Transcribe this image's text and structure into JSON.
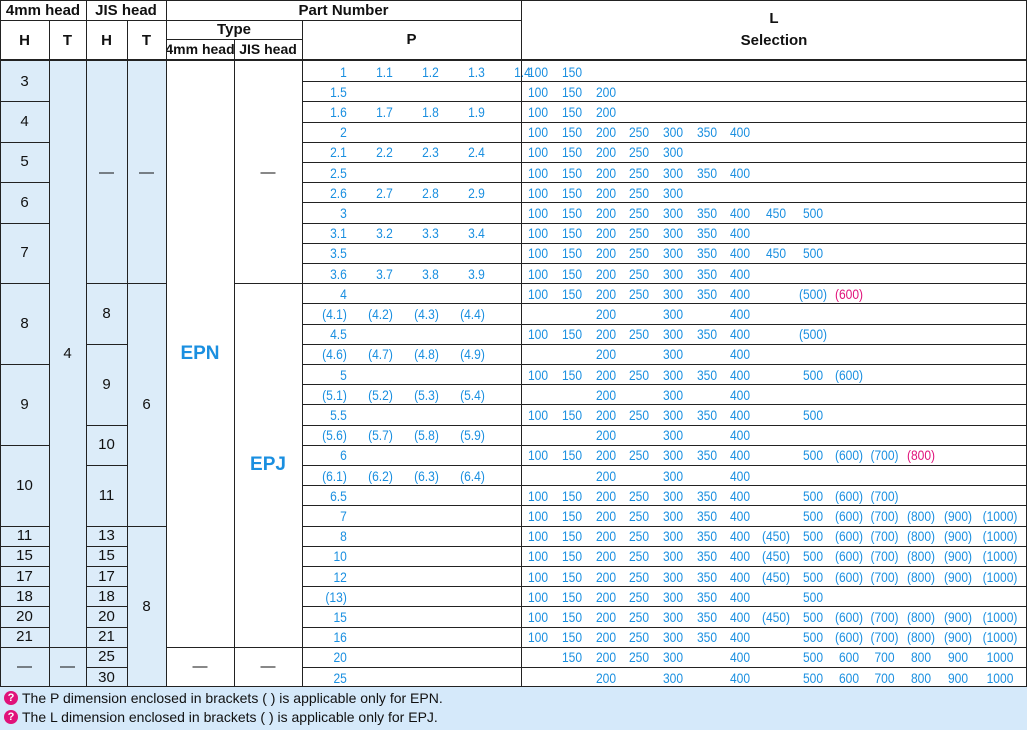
{
  "header": {
    "group_4mm": "4mm head",
    "group_jis": "JIS head",
    "part_number": "Part Number",
    "type": "Type",
    "type_4mm": "4mm head",
    "type_jis": "JIS head",
    "h": "H",
    "t": "T",
    "p": "P",
    "l": "L",
    "selection": "Selection"
  },
  "rows": [
    {
      "p": [
        "1",
        "1.1",
        "1.2",
        "1.3",
        "1.4"
      ],
      "l": [
        "100",
        "150",
        "",
        "",
        "",
        "",
        "",
        "",
        "",
        "",
        "",
        "",
        "",
        ""
      ]
    },
    {
      "p": [
        "1.5"
      ],
      "l": [
        "100",
        "150",
        "200",
        "",
        "",
        "",
        "",
        "",
        "",
        "",
        "",
        "",
        "",
        ""
      ]
    },
    {
      "p": [
        "1.6",
        "1.7",
        "1.8",
        "1.9"
      ],
      "l": [
        "100",
        "150",
        "200",
        "",
        "",
        "",
        "",
        "",
        "",
        "",
        "",
        "",
        "",
        ""
      ]
    },
    {
      "p": [
        "2"
      ],
      "l": [
        "100",
        "150",
        "200",
        "250",
        "300",
        "350",
        "400",
        "",
        "",
        "",
        "",
        "",
        "",
        ""
      ]
    },
    {
      "p": [
        "2.1",
        "2.2",
        "2.3",
        "2.4"
      ],
      "l": [
        "100",
        "150",
        "200",
        "250",
        "300",
        "",
        "",
        "",
        "",
        "",
        "",
        "",
        "",
        ""
      ]
    },
    {
      "p": [
        "2.5"
      ],
      "l": [
        "100",
        "150",
        "200",
        "250",
        "300",
        "350",
        "400",
        "",
        "",
        "",
        "",
        "",
        "",
        ""
      ]
    },
    {
      "p": [
        "2.6",
        "2.7",
        "2.8",
        "2.9"
      ],
      "l": [
        "100",
        "150",
        "200",
        "250",
        "300",
        "",
        "",
        "",
        "",
        "",
        "",
        "",
        "",
        ""
      ]
    },
    {
      "p": [
        "3"
      ],
      "l": [
        "100",
        "150",
        "200",
        "250",
        "300",
        "350",
        "400",
        "450",
        "500",
        "",
        "",
        "",
        "",
        ""
      ]
    },
    {
      "p": [
        "3.1",
        "3.2",
        "3.3",
        "3.4"
      ],
      "l": [
        "100",
        "150",
        "200",
        "250",
        "300",
        "350",
        "400",
        "",
        "",
        "",
        "",
        "",
        "",
        ""
      ]
    },
    {
      "p": [
        "3.5"
      ],
      "l": [
        "100",
        "150",
        "200",
        "250",
        "300",
        "350",
        "400",
        "450",
        "500",
        "",
        "",
        "",
        "",
        ""
      ]
    },
    {
      "p": [
        "3.6",
        "3.7",
        "3.8",
        "3.9"
      ],
      "l": [
        "100",
        "150",
        "200",
        "250",
        "300",
        "350",
        "400",
        "",
        "",
        "",
        "",
        "",
        "",
        ""
      ]
    },
    {
      "p": [
        "4"
      ],
      "l": [
        "100",
        "150",
        "200",
        "250",
        "300",
        "350",
        "400",
        "",
        "(500)",
        "(600)",
        "",
        "",
        "",
        ""
      ],
      "pink": [
        9
      ]
    },
    {
      "p": [
        "(4.1)",
        "(4.2)",
        "(4.3)",
        "(4.4)"
      ],
      "l": [
        "",
        "",
        "200",
        "",
        "300",
        "",
        "400",
        "",
        "",
        "",
        "",
        "",
        "",
        ""
      ]
    },
    {
      "p": [
        "4.5"
      ],
      "l": [
        "100",
        "150",
        "200",
        "250",
        "300",
        "350",
        "400",
        "",
        "(500)",
        "",
        "",
        "",
        "",
        ""
      ]
    },
    {
      "p": [
        "(4.6)",
        "(4.7)",
        "(4.8)",
        "(4.9)"
      ],
      "l": [
        "",
        "",
        "200",
        "",
        "300",
        "",
        "400",
        "",
        "",
        "",
        "",
        "",
        "",
        ""
      ]
    },
    {
      "p": [
        "5"
      ],
      "l": [
        "100",
        "150",
        "200",
        "250",
        "300",
        "350",
        "400",
        "",
        "500",
        "(600)",
        "",
        "",
        "",
        ""
      ]
    },
    {
      "p": [
        "(5.1)",
        "(5.2)",
        "(5.3)",
        "(5.4)"
      ],
      "l": [
        "",
        "",
        "200",
        "",
        "300",
        "",
        "400",
        "",
        "",
        "",
        "",
        "",
        "",
        ""
      ]
    },
    {
      "p": [
        "5.5"
      ],
      "l": [
        "100",
        "150",
        "200",
        "250",
        "300",
        "350",
        "400",
        "",
        "500",
        "",
        "",
        "",
        "",
        ""
      ]
    },
    {
      "p": [
        "(5.6)",
        "(5.7)",
        "(5.8)",
        "(5.9)"
      ],
      "l": [
        "",
        "",
        "200",
        "",
        "300",
        "",
        "400",
        "",
        "",
        "",
        "",
        "",
        "",
        ""
      ]
    },
    {
      "p": [
        "6"
      ],
      "l": [
        "100",
        "150",
        "200",
        "250",
        "300",
        "350",
        "400",
        "",
        "500",
        "(600)",
        "(700)",
        "(800)",
        "",
        ""
      ],
      "pink": [
        11
      ]
    },
    {
      "p": [
        "(6.1)",
        "(6.2)",
        "(6.3)",
        "(6.4)"
      ],
      "l": [
        "",
        "",
        "200",
        "",
        "300",
        "",
        "400",
        "",
        "",
        "",
        "",
        "",
        "",
        ""
      ]
    },
    {
      "p": [
        "6.5"
      ],
      "l": [
        "100",
        "150",
        "200",
        "250",
        "300",
        "350",
        "400",
        "",
        "500",
        "(600)",
        "(700)",
        "",
        "",
        ""
      ]
    },
    {
      "p": [
        "7"
      ],
      "l": [
        "100",
        "150",
        "200",
        "250",
        "300",
        "350",
        "400",
        "",
        "500",
        "(600)",
        "(700)",
        "(800)",
        "(900)",
        "(1000)"
      ]
    },
    {
      "p": [
        "8"
      ],
      "l": [
        "100",
        "150",
        "200",
        "250",
        "300",
        "350",
        "400",
        "(450)",
        "500",
        "(600)",
        "(700)",
        "(800)",
        "(900)",
        "(1000)"
      ]
    },
    {
      "p": [
        "10"
      ],
      "l": [
        "100",
        "150",
        "200",
        "250",
        "300",
        "350",
        "400",
        "(450)",
        "500",
        "(600)",
        "(700)",
        "(800)",
        "(900)",
        "(1000)"
      ]
    },
    {
      "p": [
        "12"
      ],
      "l": [
        "100",
        "150",
        "200",
        "250",
        "300",
        "350",
        "400",
        "(450)",
        "500",
        "(600)",
        "(700)",
        "(800)",
        "(900)",
        "(1000)"
      ]
    },
    {
      "p": [
        "(13)"
      ],
      "l": [
        "100",
        "150",
        "200",
        "250",
        "300",
        "350",
        "400",
        "",
        "500",
        "",
        "",
        "",
        "",
        ""
      ]
    },
    {
      "p": [
        "15"
      ],
      "l": [
        "100",
        "150",
        "200",
        "250",
        "300",
        "350",
        "400",
        "(450)",
        "500",
        "(600)",
        "(700)",
        "(800)",
        "(900)",
        "(1000)"
      ]
    },
    {
      "p": [
        "16"
      ],
      "l": [
        "100",
        "150",
        "200",
        "250",
        "300",
        "350",
        "400",
        "",
        "500",
        "(600)",
        "(700)",
        "(800)",
        "(900)",
        "(1000)"
      ]
    },
    {
      "p": [
        "20"
      ],
      "l": [
        "",
        "150",
        "200",
        "250",
        "300",
        "",
        "400",
        "",
        "500",
        "600",
        "700",
        "800",
        "900",
        "1000"
      ]
    },
    {
      "p": [
        "25"
      ],
      "l": [
        "",
        "",
        "200",
        "",
        "300",
        "",
        "400",
        "",
        "500",
        "600",
        "700",
        "800",
        "900",
        "1000"
      ]
    }
  ],
  "spans": {
    "h4": [
      {
        "text": "3",
        "r": [
          0,
          1
        ]
      },
      {
        "text": "4",
        "r": [
          2,
          3
        ]
      },
      {
        "text": "5",
        "r": [
          4,
          5
        ]
      },
      {
        "text": "6",
        "r": [
          6,
          7
        ]
      },
      {
        "text": "7",
        "r": [
          8,
          10
        ]
      },
      {
        "text": "8",
        "r": [
          11,
          14
        ]
      },
      {
        "text": "9",
        "r": [
          15,
          18
        ]
      },
      {
        "text": "10",
        "r": [
          19,
          22
        ]
      },
      {
        "text": "11",
        "r": [
          23,
          23
        ]
      },
      {
        "text": "15",
        "r": [
          24,
          24
        ]
      },
      {
        "text": "17",
        "r": [
          25,
          25
        ]
      },
      {
        "text": "18",
        "r": [
          26,
          26
        ]
      },
      {
        "text": "20",
        "r": [
          27,
          27
        ]
      },
      {
        "text": "21",
        "r": [
          28,
          28
        ]
      },
      {
        "text": "—",
        "r": [
          29,
          30
        ]
      }
    ],
    "t4": [
      {
        "text": "4",
        "r": [
          0,
          28
        ]
      },
      {
        "text": "—",
        "r": [
          29,
          30
        ]
      }
    ],
    "hj": [
      {
        "text": "—",
        "r": [
          0,
          10
        ]
      },
      {
        "text": "8",
        "r": [
          11,
          13
        ]
      },
      {
        "text": "9",
        "r": [
          14,
          17
        ]
      },
      {
        "text": "10",
        "r": [
          18,
          19
        ]
      },
      {
        "text": "11",
        "r": [
          20,
          22
        ]
      },
      {
        "text": "13",
        "r": [
          23,
          23
        ]
      },
      {
        "text": "15",
        "r": [
          24,
          24
        ]
      },
      {
        "text": "17",
        "r": [
          25,
          25
        ]
      },
      {
        "text": "18",
        "r": [
          26,
          26
        ]
      },
      {
        "text": "20",
        "r": [
          27,
          27
        ]
      },
      {
        "text": "21",
        "r": [
          28,
          28
        ]
      },
      {
        "text": "25",
        "r": [
          29,
          29
        ]
      },
      {
        "text": "30",
        "r": [
          30,
          30
        ]
      }
    ],
    "tj": [
      {
        "text": "—",
        "r": [
          0,
          10
        ]
      },
      {
        "text": "6",
        "r": [
          11,
          22
        ]
      },
      {
        "text": "8",
        "r": [
          23,
          30
        ]
      }
    ],
    "type4": [
      {
        "text": "EPN",
        "r": [
          0,
          28
        ]
      },
      {
        "text": "—",
        "r": [
          29,
          30
        ]
      }
    ],
    "typej": [
      {
        "text": "—",
        "r": [
          0,
          10
        ]
      },
      {
        "text": "EPJ",
        "r": [
          11,
          28
        ]
      },
      {
        "text": "—",
        "r": [
          29,
          30
        ]
      }
    ]
  },
  "footnotes": [
    "The P dimension enclosed in brackets (   ) is applicable only for EPN.",
    "The L dimension enclosed in brackets (   ) is applicable only for EPJ."
  ],
  "colors": {
    "accent_blue": "#1a8fe0",
    "pink": "#e0127a",
    "pale_blue": "#dcecf9",
    "foot_bg": "#d5e9fa"
  }
}
